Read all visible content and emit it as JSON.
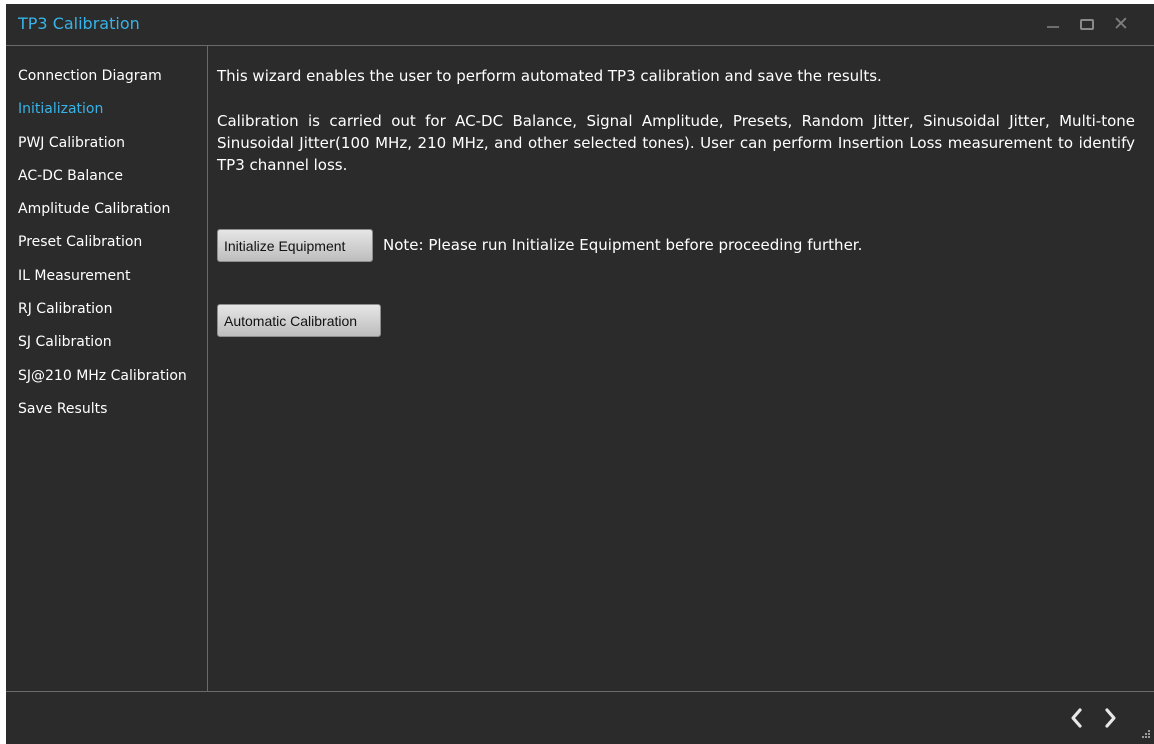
{
  "window": {
    "title": "TP3 Calibration",
    "accent_color": "#37b3e8",
    "background_color": "#2b2b2b",
    "controls": {
      "minimize_icon": "minimize-icon",
      "maximize_icon": "maximize-icon",
      "close_icon": "close-icon",
      "close_glyph": "✕"
    }
  },
  "sidebar": {
    "items": [
      {
        "label": "Connection Diagram",
        "active": false
      },
      {
        "label": "Initialization",
        "active": true
      },
      {
        "label": "PWJ Calibration",
        "active": false
      },
      {
        "label": "AC-DC Balance",
        "active": false
      },
      {
        "label": "Amplitude Calibration",
        "active": false
      },
      {
        "label": "Preset Calibration",
        "active": false
      },
      {
        "label": "IL Measurement",
        "active": false
      },
      {
        "label": "RJ Calibration",
        "active": false
      },
      {
        "label": "SJ Calibration",
        "active": false
      },
      {
        "label": "SJ@210 MHz Calibration",
        "active": false
      },
      {
        "label": "Save Results",
        "active": false
      }
    ]
  },
  "main": {
    "intro": "This wizard enables the user to perform automated TP3 calibration and save the results.",
    "description": "Calibration is carried out for AC-DC Balance, Signal Amplitude, Presets, Random Jitter, Sinusoidal Jitter, Multi-tone Sinusoidal Jitter(100 MHz, 210 MHz, and other selected tones). User can perform Insertion Loss measurement to identify TP3 channel loss.",
    "initialize_button_label": "Initialize Equipment",
    "note": "Note: Please run Initialize Equipment before proceeding further.",
    "automatic_button_label": "Automatic Calibration"
  },
  "footer": {
    "back_icon": "chevron-left-icon",
    "next_icon": "chevron-right-icon",
    "resize_icon": "resize-grip-icon"
  }
}
